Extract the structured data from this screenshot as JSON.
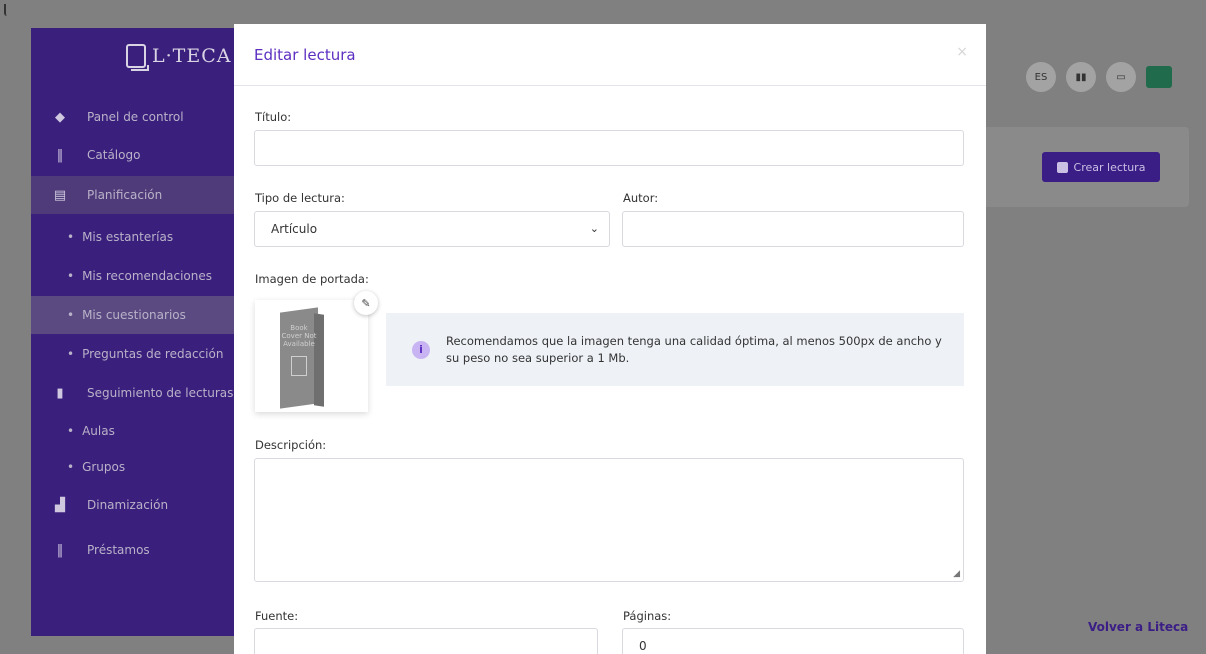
{
  "app": {
    "logo_text": "L·TECA",
    "sidebar": {
      "items": [
        {
          "label": "Panel de control",
          "icon": "diamond-icon"
        },
        {
          "label": "Catálogo",
          "icon": "books-icon"
        },
        {
          "label": "Planificación",
          "icon": "document-icon"
        },
        {
          "label": "Mis estanterías"
        },
        {
          "label": "Mis recomendaciones"
        },
        {
          "label": "Mis cuestionarios"
        },
        {
          "label": "Preguntas de redacción"
        },
        {
          "label": "Seguimiento de lecturas",
          "icon": "bar-chart-icon"
        },
        {
          "label": "Aulas"
        },
        {
          "label": "Grupos"
        },
        {
          "label": "Dinamización",
          "icon": "steps-icon"
        },
        {
          "label": "Préstamos",
          "icon": "books-icon"
        }
      ]
    },
    "top_right": {
      "language": "ES"
    },
    "crear_button": "Crear lectura",
    "volver_link": "Volver a Liteca"
  },
  "modal": {
    "title": "Editar lectura",
    "fields": {
      "titulo_label": "Título:",
      "titulo_value": "",
      "tipo_label": "Tipo de lectura:",
      "tipo_value": "Artículo",
      "autor_label": "Autor:",
      "autor_value": "",
      "imagen_label": "Imagen de portada:",
      "cover_placeholder": "Book Cover Not Available",
      "info_text": "Recomendamos que la imagen tenga una calidad óptima, al menos 500px de ancho y su peso no sea superior a 1 Mb.",
      "descripcion_label": "Descripción:",
      "descripcion_value": "",
      "fuente_label": "Fuente:",
      "fuente_value": "",
      "paginas_label": "Páginas:",
      "paginas_value": "0"
    }
  }
}
